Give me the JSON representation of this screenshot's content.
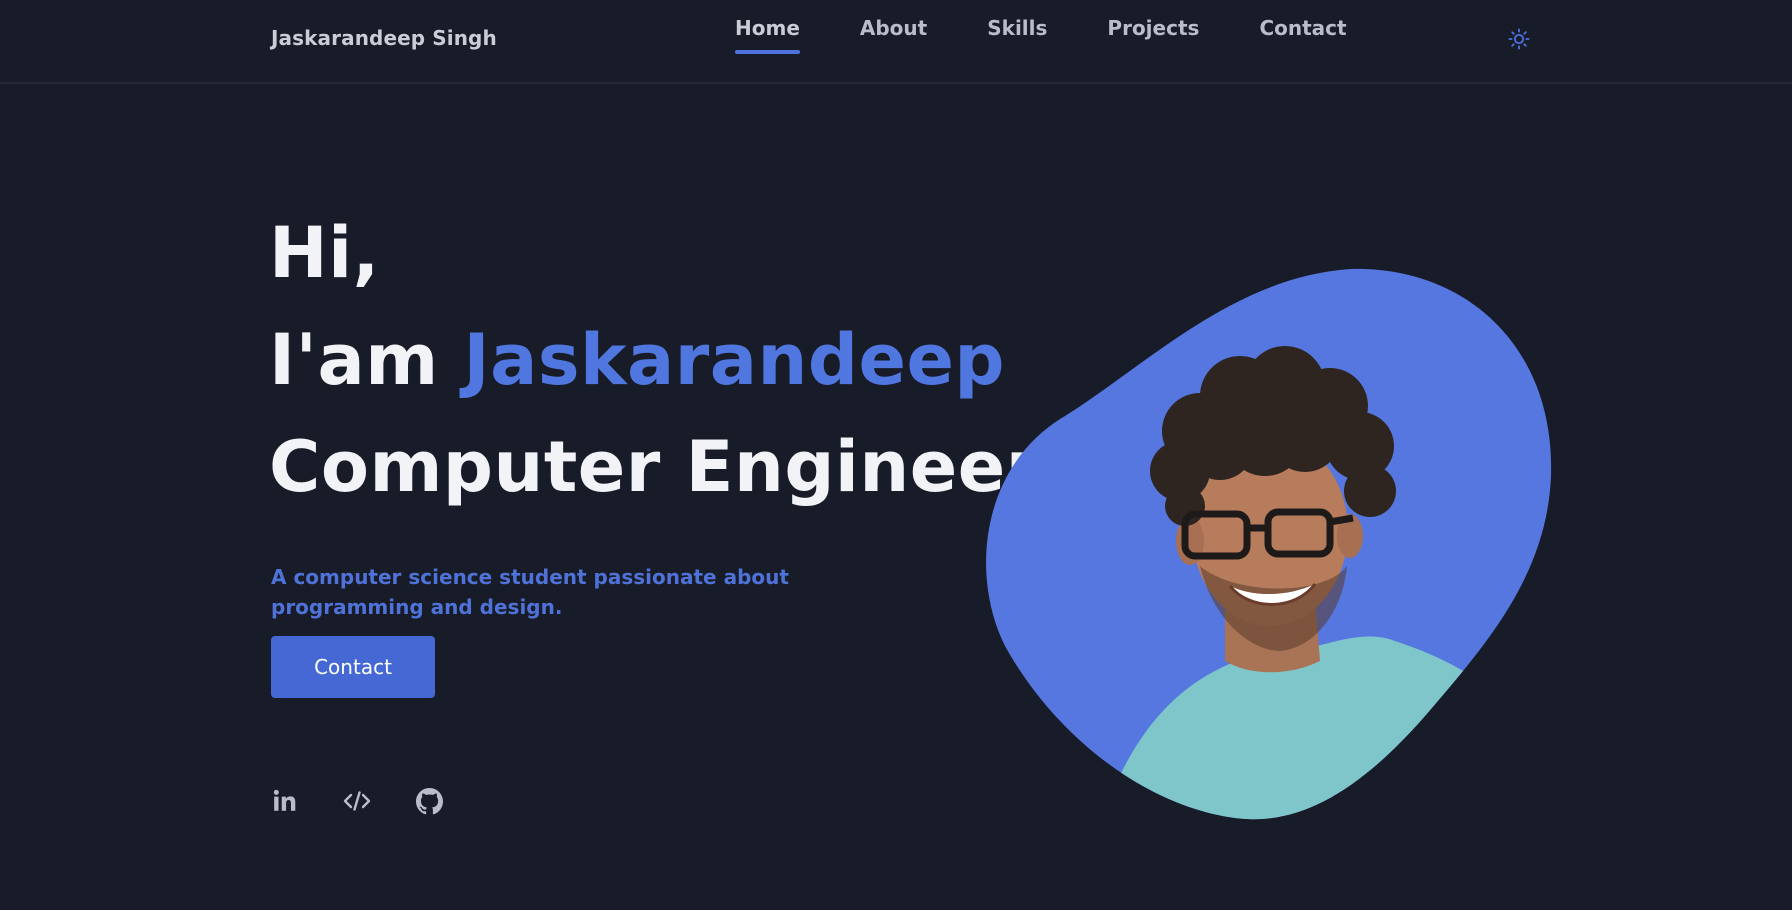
{
  "header": {
    "brand": "Jaskarandeep Singh",
    "nav": [
      "Home",
      "About",
      "Skills",
      "Projects",
      "Contact"
    ],
    "active_nav": "Home",
    "theme_icon": "sun-icon"
  },
  "hero": {
    "greeting": "Hi,",
    "intro_prefix": "I'am ",
    "name": "Jaskarandeep",
    "role": "Computer Engineer",
    "description": "A computer science student passionate about programming and design.",
    "contact_button": "Contact"
  },
  "socials": [
    {
      "name": "linkedin-icon",
      "label": "in"
    },
    {
      "name": "code-icon",
      "label": "</>"
    },
    {
      "name": "github-icon"
    }
  ],
  "colors": {
    "background": "#181b28",
    "accent": "#4e72de",
    "heading": "#f2f3f6",
    "nav_text": "#b9bdc9",
    "button": "#4568d4",
    "blob": "#5577df",
    "shirt": "#7fc6cb"
  }
}
